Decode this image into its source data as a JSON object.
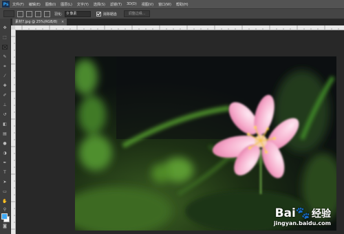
{
  "app": {
    "logo": "Ps"
  },
  "menubar": {
    "items": [
      "文件(F)",
      "编辑(E)",
      "图像(I)",
      "图层(L)",
      "文字(Y)",
      "选择(S)",
      "滤镜(T)",
      "3D(D)",
      "视图(V)",
      "窗口(W)",
      "帮助(H)"
    ]
  },
  "options": {
    "feather_label": "羽化:",
    "feather_value": "0 像素",
    "antialias_label": "消除锯齿",
    "refine_edge_label": "调整边缘..."
  },
  "document": {
    "tab_title": "素材7.jpg @ 25%(RGB/8)",
    "tab_close": "×"
  },
  "tools": {
    "icons": [
      "move-icon",
      "marquee-icon",
      "lasso-icon",
      "quick-select-icon",
      "crop-icon",
      "eyedropper-icon",
      "healing-brush-icon",
      "brush-icon",
      "clone-stamp-icon",
      "history-brush-icon",
      "eraser-icon",
      "gradient-icon",
      "blur-icon",
      "dodge-icon",
      "pen-icon",
      "type-icon",
      "path-select-icon",
      "shape-icon",
      "hand-icon",
      "zoom-icon"
    ],
    "foreground_color": "#3fa9f5",
    "background_color": "#ffffff"
  },
  "watermark": {
    "brand": "Bai",
    "brand_cn": "经验",
    "url": "jingyan.baidu.com"
  }
}
